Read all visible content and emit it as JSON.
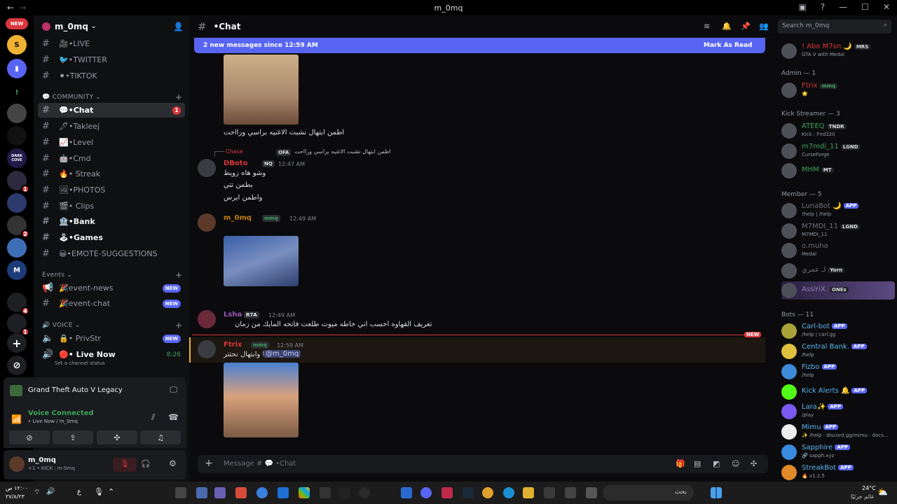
{
  "window": {
    "title": "m_0mq",
    "back": "←",
    "forward": "→"
  },
  "rail": {
    "new_label": "NEW",
    "badges": [
      "1",
      "2",
      "4",
      "1"
    ],
    "dark_cove": "DARK COVE"
  },
  "server": {
    "name": "m_0mq"
  },
  "channels": [
    {
      "label": "•LIVE",
      "emoji": "🎥"
    },
    {
      "label": "•TWITTER",
      "emoji": "🐦"
    },
    {
      "label": "•TIKTOK",
      "emoji": "⚫"
    }
  ],
  "community": {
    "label": "COMMUNITY",
    "channels": [
      {
        "label": "•Chat",
        "emoji": "💬",
        "count": "1"
      },
      {
        "label": "•Takleej",
        "emoji": "🖊"
      },
      {
        "label": "•Level",
        "emoji": "📈"
      },
      {
        "label": "•Cmd",
        "emoji": "🤖"
      },
      {
        "label": "• Streak",
        "emoji": "🔥"
      },
      {
        "label": "•PHOTOS",
        "emoji": "🖼"
      },
      {
        "label": "• Clips",
        "emoji": "🎬"
      },
      {
        "label": "•Bank",
        "emoji": "🏦"
      },
      {
        "label": "•Games",
        "emoji": "🕹"
      },
      {
        "label": "•EMOTE-SUGGESTIONS",
        "emoji": "😀"
      }
    ]
  },
  "events": {
    "label": "Events",
    "channels": [
      {
        "label": "event-news",
        "emoji": "🎉",
        "new": "NEW"
      },
      {
        "label": "event-chat",
        "emoji": "🎉",
        "new": "NEW"
      }
    ]
  },
  "voice": {
    "label": "VOICE",
    "channels": [
      {
        "label": "• PrivStr",
        "emoji": "🔒",
        "new": "NEW"
      },
      {
        "label": "• Live Now",
        "emoji": "🔴",
        "time": "8:26",
        "status": "Set a channel status"
      }
    ]
  },
  "game_panel": {
    "title": "Grand Theft Auto V Legacy"
  },
  "voice_panel": {
    "status": "Voice Connected",
    "channel": "• Live Now / m_0mq"
  },
  "user_panel": {
    "name": "m_0mq",
    "status": "+1 • KICK : m-0mq"
  },
  "chat": {
    "channel": "•Chat",
    "new_messages": "2 new messages since 12:59 AM",
    "mark_read": "Mark As Read",
    "messages": [
      {
        "text": "اطمن ابتهال نشبت الاغنيه براسي ورااحت"
      },
      {
        "reply": "اطمن ابتهال نشبت الاغنيه براسي ورااحت",
        "reply_user": "Chase",
        "reply_tag": "OFA",
        "user": "DBoto",
        "tag": "NQ",
        "time": "12:47 AM",
        "lines": [
          "وشو هاه زويط",
          "بطمن تتي",
          "واطمن ايرس"
        ]
      },
      {
        "user": "m_0mq",
        "tag": "mmq",
        "time": "12:49 AM"
      },
      {
        "user": "Lsha",
        "tag": "R7A",
        "time": "12:49 AM",
        "text": "تعريف القهاوه احسب اني حاطه ميوت طلعت فاتحه المايك من زمان"
      },
      {
        "new_label": "NEW",
        "user": "Ftrix",
        "tag": "mmq",
        "time": "12:59 AM",
        "mention": "@m_0mq",
        "text": "انا وابتهال نحتتر"
      }
    ],
    "composer_placeholder": "Message # 💬 •Chat"
  },
  "members": {
    "search": "Search m_0mq",
    "top": {
      "name": "! Abo M7sn 🌙",
      "tag": "MRS",
      "sub": "GTA V with Medal"
    },
    "groups": [
      {
        "label": "Admin — 1",
        "items": [
          {
            "name": "Ftrix",
            "tag": "mmq",
            "sub": "🌟"
          }
        ]
      },
      {
        "label": "Kick Streamer — 3",
        "items": [
          {
            "name": "ATEEQ",
            "tag": "TNDR",
            "sub": "Kick : Fnd320"
          },
          {
            "name": "m7mdi_11",
            "tag": "LGND",
            "sub": "CurseForge"
          },
          {
            "name": "MHM",
            "tag": "MT",
            "sub": ""
          }
        ]
      },
      {
        "label": "Member — 5",
        "items": [
          {
            "name": "LunaBot 🌙",
            "app": "APP",
            "sub": "!help | /help"
          },
          {
            "name": "M7MDI_11",
            "tag": "LGND",
            "sub": "M7MDI_11"
          },
          {
            "name": "o.muha",
            "sub": "Medal"
          },
          {
            "name": "لـ عمري",
            "tag": "Yorn",
            "sub": ""
          },
          {
            "name": "AssiriX.",
            "tag": "ONEs",
            "sub": ""
          }
        ]
      },
      {
        "label": "Bots — 11",
        "items": [
          {
            "name": "Carl-bot",
            "app": "APP",
            "sub": "/help | carl.gg"
          },
          {
            "name": "Central Bank.",
            "app": "APP",
            "sub": "/help"
          },
          {
            "name": "Fizbo",
            "app": "APP",
            "sub": "/help"
          },
          {
            "name": "Kick Alerts 🔔",
            "app": "APP",
            "sub": ""
          },
          {
            "name": "Lara✨",
            "app": "APP",
            "sub": "/play"
          },
          {
            "name": "Mimu",
            "app": "APP",
            "sub": "✨ /help · discord.gg/mimu · docs..."
          },
          {
            "name": "Sapphire",
            "app": "APP",
            "sub": "🔗 sapph.xyz"
          },
          {
            "name": "StreakBot",
            "app": "APP",
            "sub": "🔥 v1.2.5"
          }
        ]
      }
    ]
  },
  "taskbar": {
    "search": "بحث",
    "clock": "١٢:٠٠ ص",
    "date": "٢٧/٨/٢٣",
    "weather": "24°C",
    "weather_sub": "غائم جزئيًا",
    "lang": "ع"
  }
}
